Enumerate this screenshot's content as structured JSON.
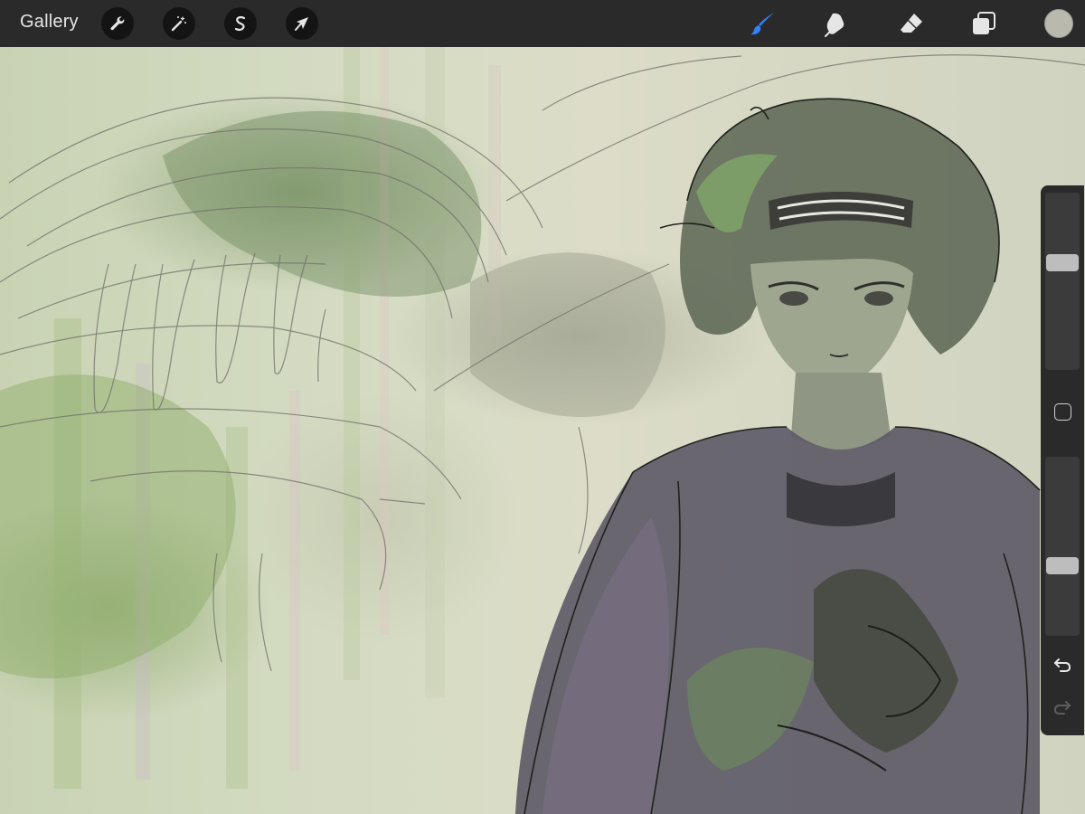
{
  "topbar": {
    "gallery_label": "Gallery",
    "left_tools": [
      {
        "icon": "wrench-icon",
        "name": "actions-button"
      },
      {
        "icon": "magic-wand-icon",
        "name": "adjustments-button"
      },
      {
        "icon": "selection-s-icon",
        "name": "selection-button"
      },
      {
        "icon": "arrow-cursor-icon",
        "name": "transform-button"
      }
    ],
    "right_tools": [
      {
        "icon": "brush-icon",
        "name": "paint-brush-button",
        "active": true
      },
      {
        "icon": "smudge-icon",
        "name": "smudge-button",
        "active": false
      },
      {
        "icon": "eraser-icon",
        "name": "eraser-button",
        "active": false
      },
      {
        "icon": "layers-icon",
        "name": "layers-button",
        "active": false
      }
    ],
    "current_color": "#b9b9ae"
  },
  "sidebar": {
    "brush_size_level": 0.62,
    "brush_opacity_level": 0.38,
    "undo_icon": "undo-arrow-icon",
    "redo_icon": "redo-arrow-icon"
  },
  "colors": {
    "bar_background": "#2a2a2a",
    "active_tool": "#2f82ff",
    "icon_default": "#e6e6e6"
  }
}
